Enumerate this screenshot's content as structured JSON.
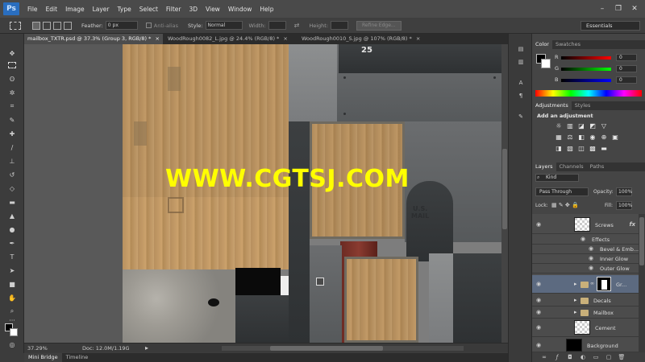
{
  "app": {
    "logo": "Ps"
  },
  "menu": [
    "File",
    "Edit",
    "Image",
    "Layer",
    "Type",
    "Select",
    "Filter",
    "3D",
    "View",
    "Window",
    "Help"
  ],
  "window_controls": {
    "minimize": "–",
    "restore": "❐",
    "close": "✕"
  },
  "options_bar": {
    "feather_label": "Feather:",
    "feather_value": "0 px",
    "anti_alias_label": "Anti-alias",
    "style_label": "Style:",
    "style_value": "Normal",
    "width_label": "Width:",
    "height_label": "Height:",
    "refine_edge": "Refine Edge...",
    "workspace": "Essentials"
  },
  "tabs": [
    {
      "title": "mailbox_TXTR.psd @ 37.3% (Group 3, RGB/8) *",
      "close": "×"
    },
    {
      "title": "WoodRough0082_L.jpg @ 24.4% (RGB/8) *",
      "close": "×"
    },
    {
      "title": "WoodRough0010_S.jpg @ 107% (RGB/8) *",
      "close": "×"
    }
  ],
  "canvas": {
    "watermark": "WWW.CGTSJ.COM",
    "mail_text_1": "U.S.",
    "mail_text_2": "MAIL",
    "stencil_number": "25"
  },
  "status": {
    "zoom": "37.29%",
    "doc": "Doc: 12.0M/1.19G"
  },
  "bottom_tabs": [
    "Mini Bridge",
    "Timeline"
  ],
  "color_panel": {
    "tabs": [
      "Color",
      "Swatches"
    ],
    "channels": [
      {
        "label": "R",
        "value": "0"
      },
      {
        "label": "G",
        "value": "0"
      },
      {
        "label": "B",
        "value": "0"
      }
    ]
  },
  "adjustments_panel": {
    "tabs": [
      "Adjustments",
      "Styles"
    ],
    "heading": "Add an adjustment"
  },
  "layers_panel": {
    "tabs": [
      "Layers",
      "Channels",
      "Paths"
    ],
    "kind_label": "Kind",
    "blend_mode": "Pass Through",
    "opacity_label": "Opacity:",
    "opacity_value": "100%",
    "lock_label": "Lock:",
    "fill_label": "Fill:",
    "fill_value": "100%",
    "layers": [
      {
        "name": "Screws",
        "fx": "fx"
      },
      {
        "name": "Effects"
      },
      {
        "name": "Bevel & Emb..."
      },
      {
        "name": "Inner Glow"
      },
      {
        "name": "Outer Glow"
      },
      {
        "name": "Gr..."
      },
      {
        "name": "Decals"
      },
      {
        "name": "Mailbox"
      },
      {
        "name": "Cement"
      },
      {
        "name": "Background"
      }
    ]
  }
}
